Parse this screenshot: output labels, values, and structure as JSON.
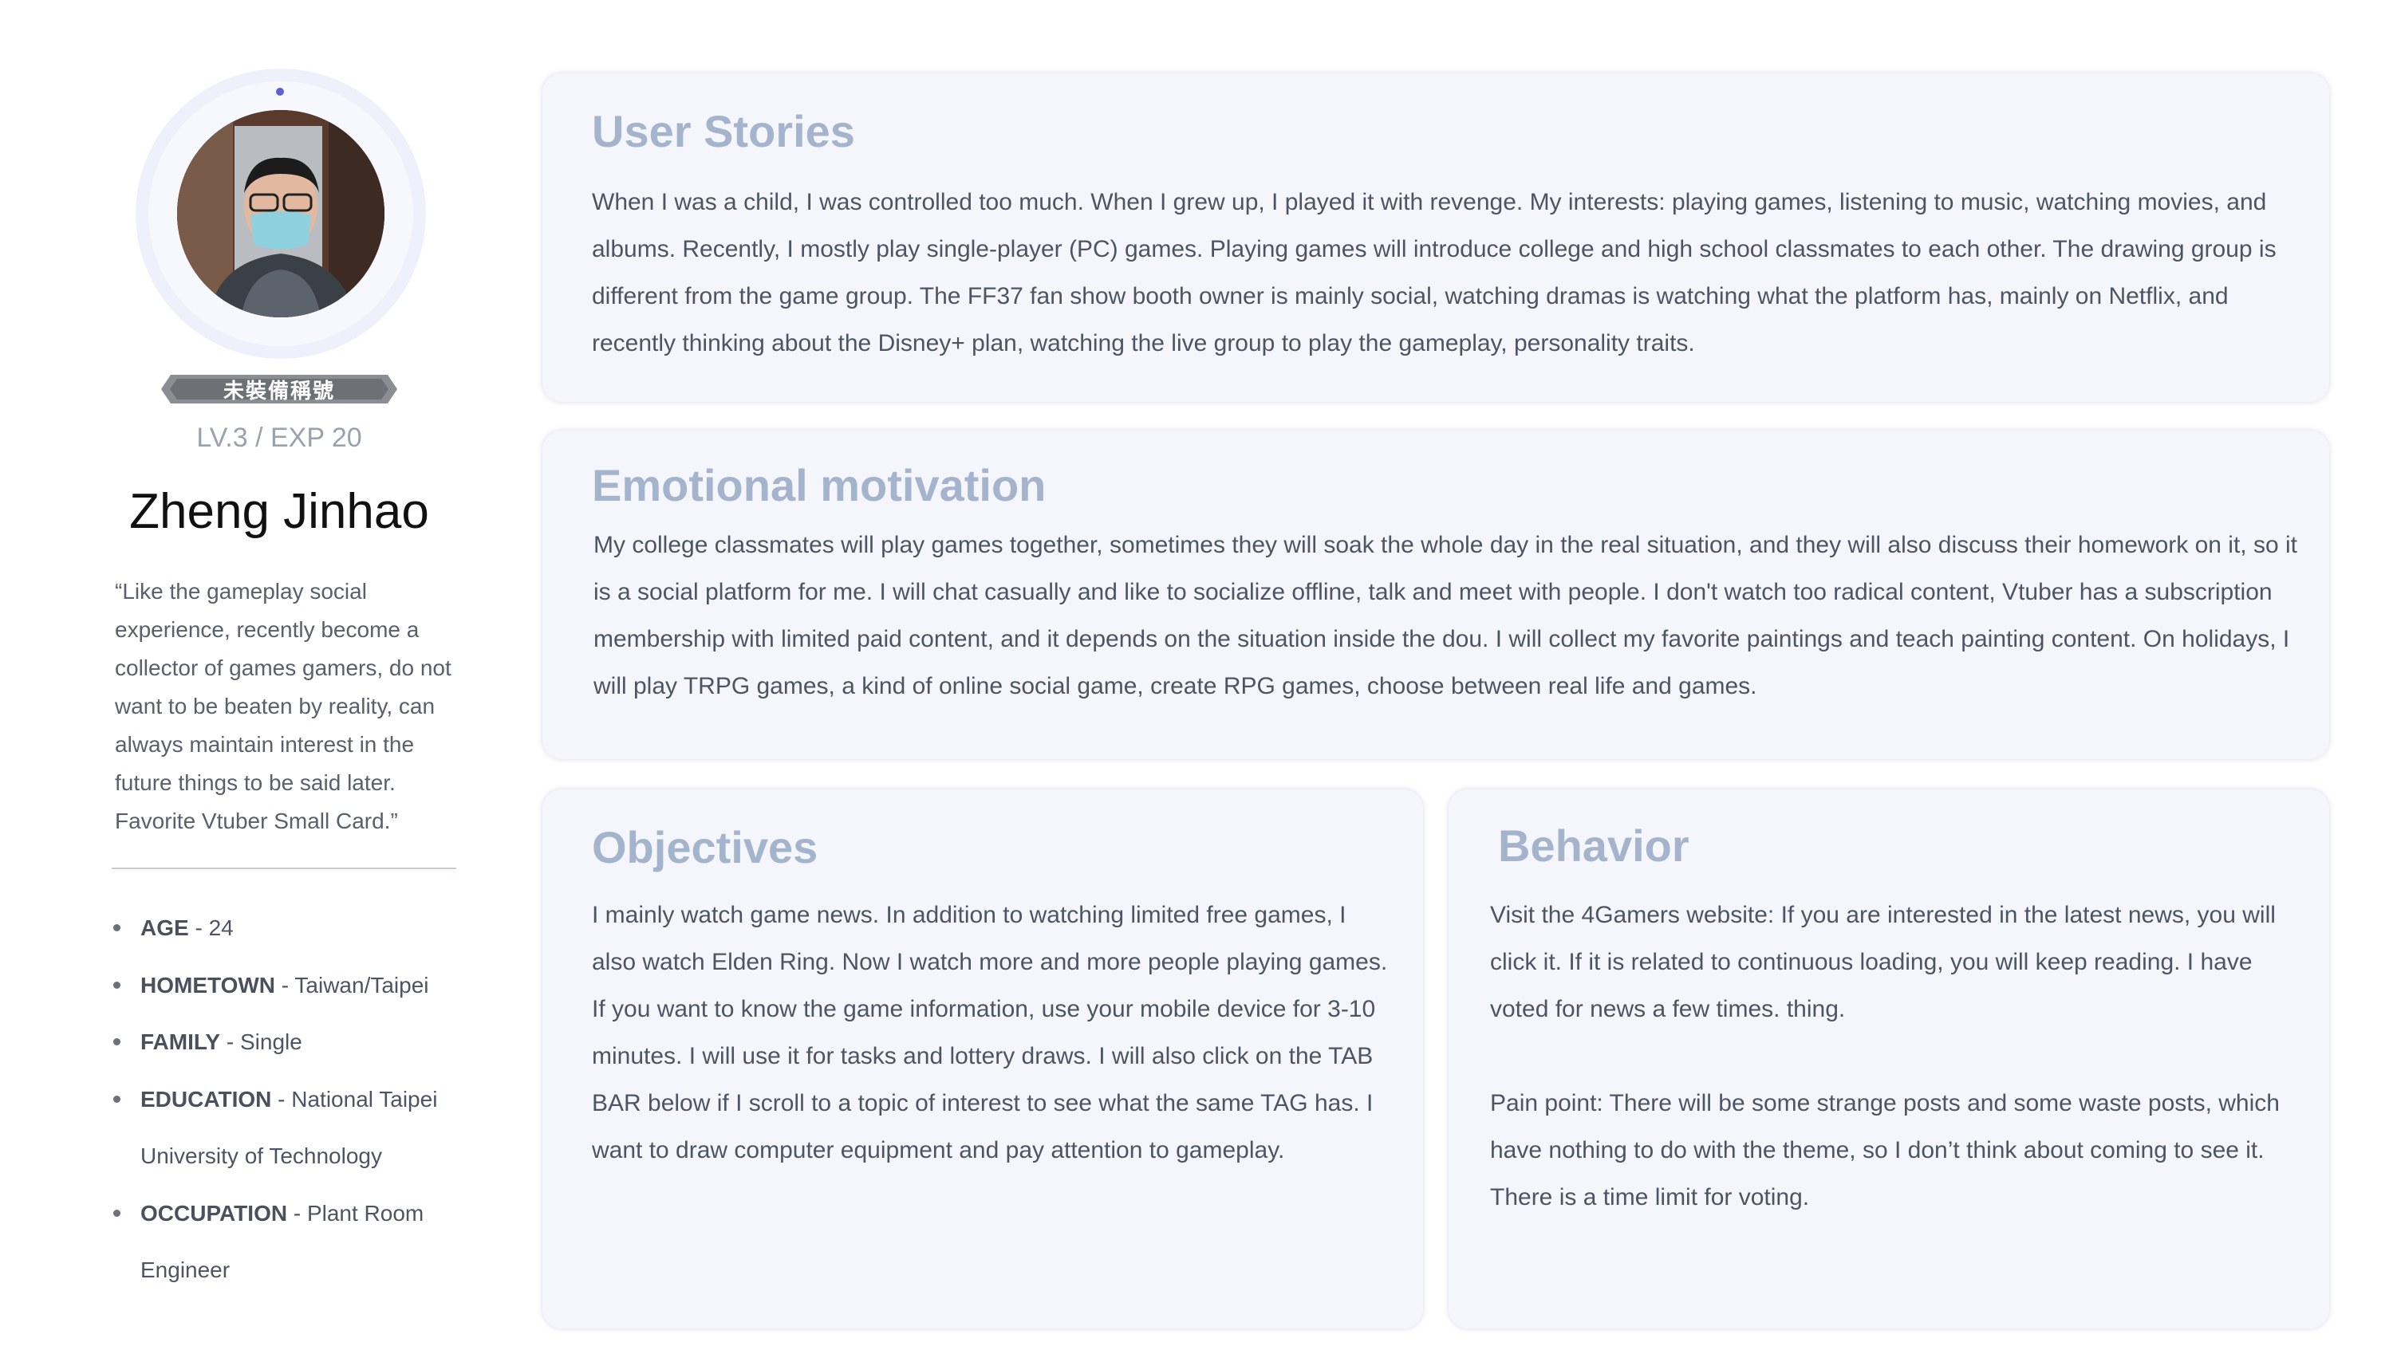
{
  "profile": {
    "title_badge": "未裝備稱號",
    "level": "LV.3 / EXP 20",
    "name": "Zheng Jinhao",
    "quote": "“Like the gameplay social experience, recently become a collector of games gamers, do not want to be beaten by reality, can always maintain interest in the future things to be said later. Favorite Vtuber Small Card.”",
    "facts": [
      {
        "key": "AGE",
        "value": " - 24"
      },
      {
        "key": "HOMETOWN",
        "value": " - Taiwan/Taipei"
      },
      {
        "key": "FAMILY",
        "value": " - Single"
      },
      {
        "key": "EDUCATION",
        "value": " - National Taipei University of Technology"
      },
      {
        "key": "OCCUPATION",
        "value": " - Plant Room Engineer"
      }
    ]
  },
  "cards": {
    "user_stories": {
      "heading": "User Stories",
      "body": "When I was a child, I was controlled too much. When I grew up, I played it with revenge. My interests: playing games, listening to music, watching movies, and albums. Recently, I mostly play single-player (PC) games. Playing games will introduce college and high school classmates to each other. The drawing group is different from the game group. The FF37 fan show booth owner is mainly social, watching dramas is watching what the platform has, mainly on Netflix, and recently thinking about the Disney+ plan, watching the live group to play the gameplay, personality traits."
    },
    "emotional_motivation": {
      "heading": "Emotional motivation",
      "body": "My college classmates will play games together, sometimes they will soak the whole day in the real situation, and they will also discuss their homework on it, so it is a social platform for me. I will chat casually and like to socialize offline, talk and meet with people. I don't watch too radical content, Vtuber has a subscription membership with limited paid content, and it depends on the situation inside the dou. I will collect my favorite paintings and teach painting content. On holidays, I will play TRPG games, a kind of online social game, create RPG games, choose between real life and games."
    },
    "objectives": {
      "heading": "Objectives",
      "body": "I mainly watch game news. In addition to watching limited free games, I also watch Elden Ring. Now I watch more and more people playing games. If you want to know the game information, use your mobile device for 3-10 minutes. I will use it for tasks and lottery draws. I will also click on the TAB BAR below if I scroll to a topic of interest to see what the same TAG has. I want to draw computer equipment and pay attention to gameplay."
    },
    "behavior": {
      "heading": "Behavior",
      "body": "Visit the 4Gamers website: If you are interested in the latest news, you will click it. If it is related to continuous loading, you will keep reading. I have voted for news a few times. thing.\n\nPain point: There will be some strange posts and some waste posts, which have nothing to do with the theme, so I don’t think about coming to see it. There is a time limit for voting."
    }
  },
  "colors": {
    "heading": "#a5b4cd",
    "card_bg": "#f5f6fb",
    "body_text": "#4d5563",
    "avatar_dot": "#5b60d6"
  }
}
